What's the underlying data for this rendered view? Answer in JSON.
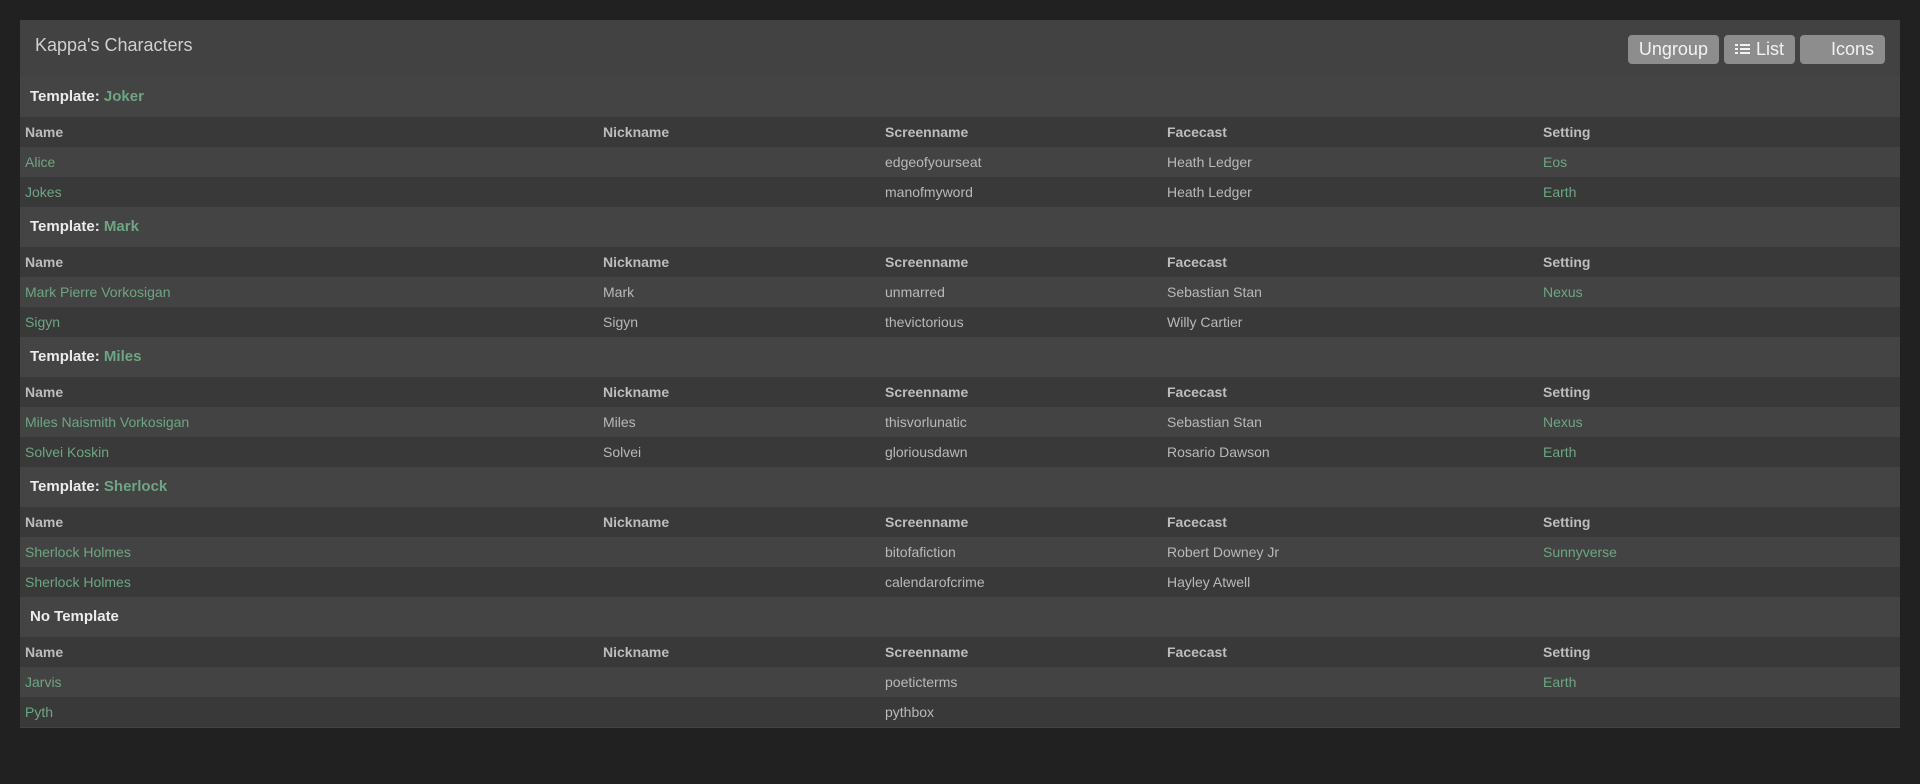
{
  "panel": {
    "title": "Kappa's Characters",
    "buttons": {
      "ungroup": "Ungroup",
      "list": "List",
      "icons": "Icons"
    }
  },
  "columns": [
    "Name",
    "Nickname",
    "Screenname",
    "Facecast",
    "Setting"
  ],
  "groups": [
    {
      "prefix": "Template:",
      "template": "Joker",
      "rows": [
        {
          "name": "Alice",
          "nickname": "",
          "screenname": "edgeofyourseat",
          "facecast": "Heath Ledger",
          "setting": "Eos"
        },
        {
          "name": "Jokes",
          "nickname": "",
          "screenname": "manofmyword",
          "facecast": "Heath Ledger",
          "setting": "Earth"
        }
      ]
    },
    {
      "prefix": "Template:",
      "template": "Mark",
      "rows": [
        {
          "name": "Mark Pierre Vorkosigan",
          "nickname": "Mark",
          "screenname": "unmarred",
          "facecast": "Sebastian Stan",
          "setting": "Nexus"
        },
        {
          "name": "Sigyn",
          "nickname": "Sigyn",
          "screenname": "thevictorious",
          "facecast": "Willy Cartier",
          "setting": ""
        }
      ]
    },
    {
      "prefix": "Template:",
      "template": "Miles",
      "rows": [
        {
          "name": "Miles Naismith Vorkosigan",
          "nickname": "Miles",
          "screenname": "thisvorlunatic",
          "facecast": "Sebastian Stan",
          "setting": "Nexus"
        },
        {
          "name": "Solvei Koskin",
          "nickname": "Solvei",
          "screenname": "gloriousdawn",
          "facecast": "Rosario Dawson",
          "setting": "Earth"
        }
      ]
    },
    {
      "prefix": "Template:",
      "template": "Sherlock",
      "rows": [
        {
          "name": "Sherlock Holmes",
          "nickname": "",
          "screenname": "bitofafiction",
          "facecast": "Robert Downey Jr",
          "setting": "Sunnyverse"
        },
        {
          "name": "Sherlock Holmes",
          "nickname": "",
          "screenname": "calendarofcrime",
          "facecast": "Hayley Atwell",
          "setting": ""
        }
      ]
    },
    {
      "prefix": "No Template",
      "template": "",
      "rows": [
        {
          "name": "Jarvis",
          "nickname": "",
          "screenname": "poeticterms",
          "facecast": "",
          "setting": "Earth"
        },
        {
          "name": "Pyth",
          "nickname": "",
          "screenname": "pythbox",
          "facecast": "",
          "setting": ""
        }
      ]
    }
  ]
}
